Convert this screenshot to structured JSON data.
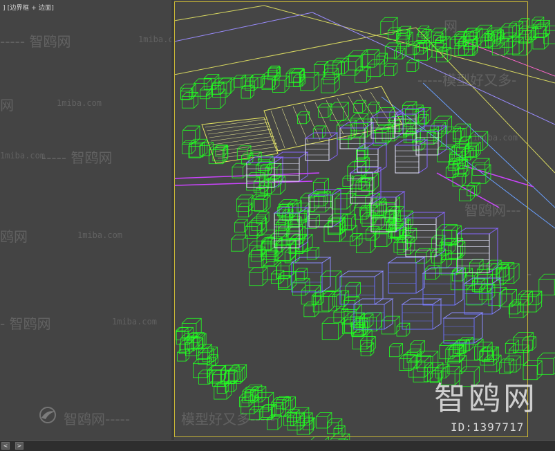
{
  "viewport_left": {
    "label": "] [边界框 + 边面]"
  },
  "watermarks": {
    "site": "智鸥网",
    "domain": "1miba.com",
    "slogan": "模型好又多",
    "dash_line": "-----",
    "brand": "智鸥网",
    "id": "ID:1397717"
  },
  "bottombar": {
    "prev": "<",
    "next": ">"
  },
  "colors": {
    "trees": "#22ff22",
    "buildings_white": "#e8e8ff",
    "buildings_purple": "#8866ff",
    "roofs_yellow": "#e8e860",
    "roads_magenta": "#cc44ff",
    "active_border": "#c9b636"
  }
}
